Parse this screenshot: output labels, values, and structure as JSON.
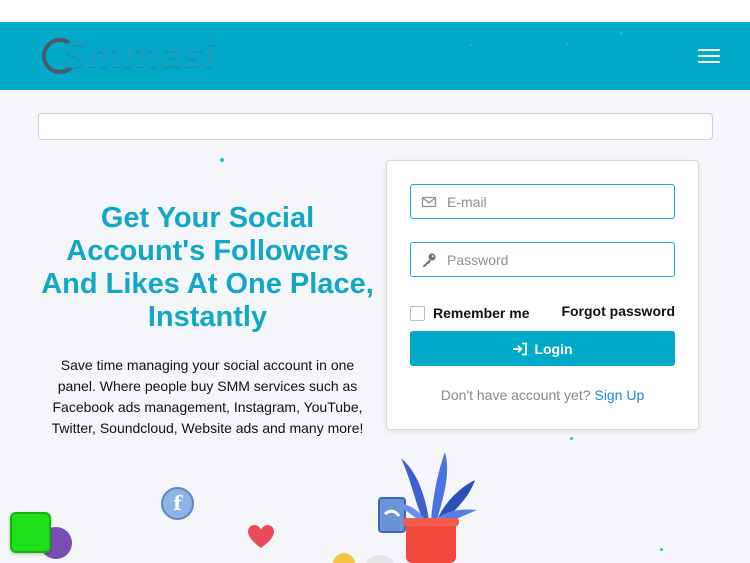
{
  "brand": {
    "logo_text": "Smmasi"
  },
  "header": {
    "menu_icon": "hamburger-icon"
  },
  "search": {
    "value": ""
  },
  "hero": {
    "headline": "Get Your Social Account's Followers And Likes At One Place, Instantly",
    "description": "Save time managing your social account in one panel. Where people buy SMM services such as Facebook ads management, Instagram, YouTube, Twitter, Soundcloud, Website ads and many more!"
  },
  "login_form": {
    "email_placeholder": "E-mail",
    "email_icon": "envelope-icon",
    "password_placeholder": "Password",
    "password_icon": "key-icon",
    "remember_label": "Remember me",
    "forgot_label": "Forgot password",
    "login_label": "Login",
    "login_icon": "sign-in-icon",
    "signup_prompt": "Don't have account yet?",
    "signup_link": "Sign Up"
  },
  "colors": {
    "brand_primary": "#02aac9",
    "headline": "#10a8c6",
    "link": "#1a88d0",
    "chat_widget": "#1fe019"
  }
}
